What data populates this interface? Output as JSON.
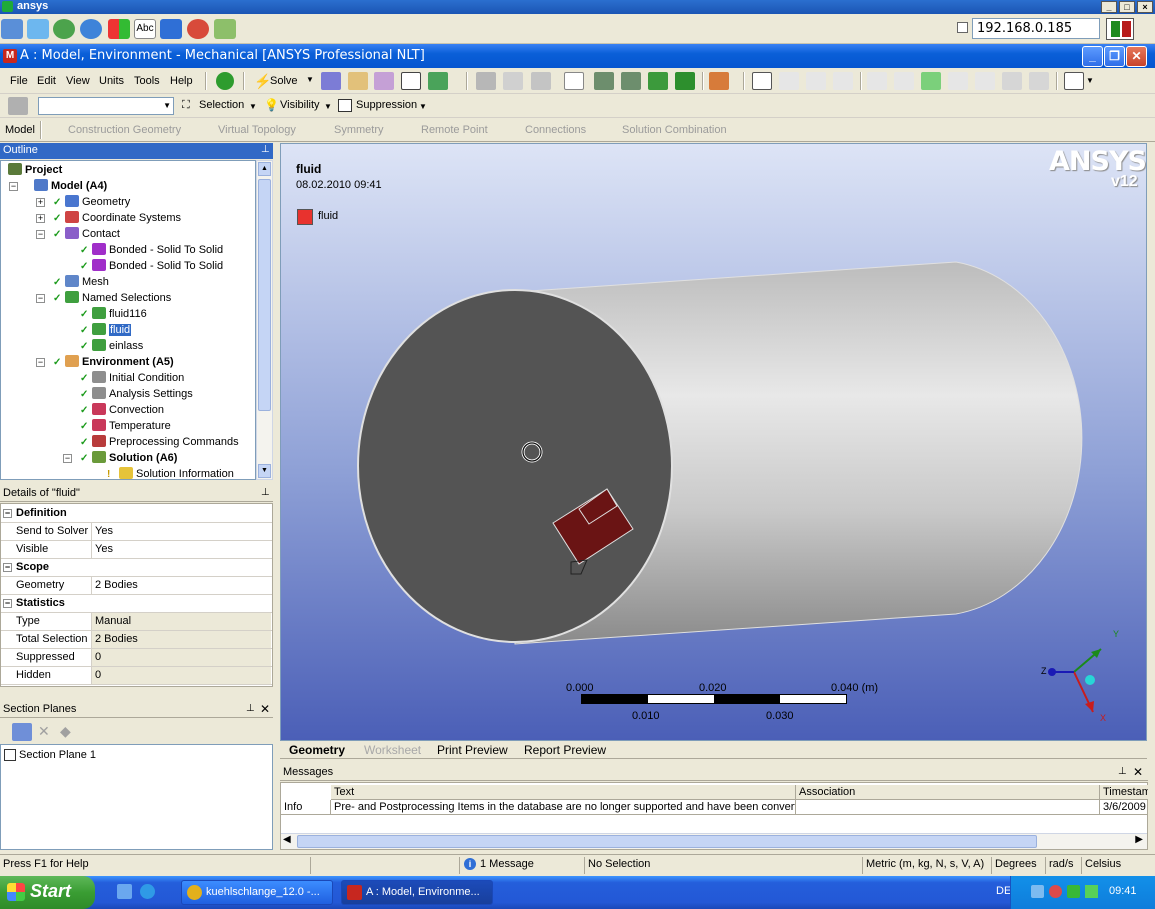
{
  "remote": {
    "title": "ansys",
    "ip_address": "192.168.0.185"
  },
  "window": {
    "title": "A : Model, Environment - Mechanical [ANSYS Professional NLT]"
  },
  "menu": {
    "items": [
      "File",
      "Edit",
      "View",
      "Units",
      "Tools",
      "Help"
    ],
    "solve_label": "Solve"
  },
  "toolbar2": {
    "selection_label": "Selection",
    "visibility_label": "Visibility",
    "suppression_label": "Suppression"
  },
  "context_bar": {
    "items": [
      "Model",
      "Construction Geometry",
      "Virtual Topology",
      "Symmetry",
      "Remote Point",
      "Connections",
      "Solution Combination"
    ]
  },
  "outline": {
    "header": "Outline",
    "rows": [
      {
        "label": "Project"
      },
      {
        "label": "Model (A4)"
      },
      {
        "label": "Geometry"
      },
      {
        "label": "Coordinate Systems"
      },
      {
        "label": "Contact"
      },
      {
        "label": "Bonded - Solid To Solid"
      },
      {
        "label": "Bonded - Solid To Solid"
      },
      {
        "label": "Mesh"
      },
      {
        "label": "Named Selections"
      },
      {
        "label": "fluid116"
      },
      {
        "label": "fluid"
      },
      {
        "label": "einlass"
      },
      {
        "label": "Environment (A5)"
      },
      {
        "label": "Initial Condition"
      },
      {
        "label": "Analysis Settings"
      },
      {
        "label": "Convection"
      },
      {
        "label": "Temperature"
      },
      {
        "label": "Preprocessing Commands"
      },
      {
        "label": "Solution (A6)"
      },
      {
        "label": "Solution Information"
      }
    ]
  },
  "details": {
    "header": "Details of \"fluid\"",
    "groups": {
      "definition": "Definition",
      "scope": "Scope",
      "statistics": "Statistics"
    },
    "rows": {
      "send_to_solver": {
        "key": "Send to Solver",
        "value": "Yes"
      },
      "visible": {
        "key": "Visible",
        "value": "Yes"
      },
      "geometry": {
        "key": "Geometry",
        "value": "2 Bodies"
      },
      "type": {
        "key": "Type",
        "value": "Manual"
      },
      "total_selection": {
        "key": "Total Selection",
        "value": "2 Bodies"
      },
      "suppressed": {
        "key": "Suppressed",
        "value": "0"
      },
      "hidden": {
        "key": "Hidden",
        "value": "0"
      }
    }
  },
  "section_planes": {
    "header": "Section Planes",
    "items": [
      "Section Plane 1"
    ]
  },
  "viewport": {
    "title": "fluid",
    "date": "08.02.2010 09:41",
    "legend_label": "fluid",
    "legend_color": "#e8322e",
    "logo_text": "ANSYS",
    "version_text": "v12",
    "scale_top": [
      "0.000",
      "0.020",
      "0.040 (m)"
    ],
    "scale_bottom": [
      "0.010",
      "0.030"
    ],
    "axes": {
      "x": "X",
      "y": "Y",
      "z": "Z"
    }
  },
  "view_tabs": [
    "Geometry",
    "Worksheet",
    "Print Preview",
    "Report Preview"
  ],
  "messages": {
    "header": "Messages",
    "columns": [
      "Text",
      "Association",
      "Timestam"
    ],
    "rows": [
      {
        "type": "Info",
        "text": "Pre- and Postprocessing Items in the database are no longer supported and have been convert",
        "association": "",
        "timestamp": "3/6/2009"
      }
    ]
  },
  "statusbar": {
    "help": "Press F1 for Help",
    "messages": "1 Message",
    "selection": "No Selection",
    "units": "Metric (m, kg, N, s, V, A)",
    "angle": "Degrees",
    "rate": "rad/s",
    "temp": "Celsius"
  },
  "taskbar": {
    "start": "Start",
    "tasks": [
      "kuehlschlange_12.0 -...",
      "A : Model, Environme..."
    ],
    "lang": "DE",
    "clock": "09:41"
  }
}
